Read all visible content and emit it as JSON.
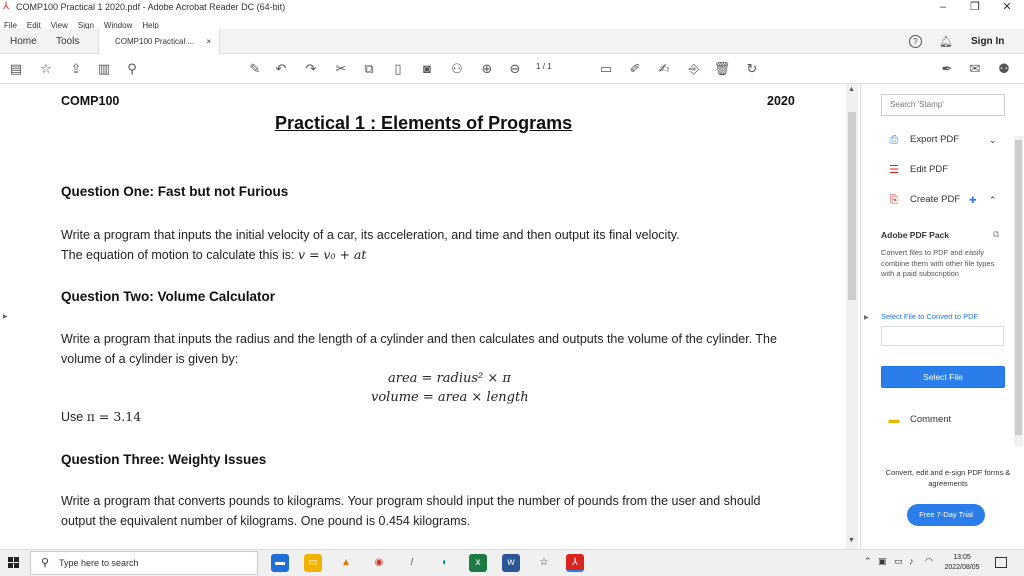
{
  "window": {
    "title": "COMP100 Practical 1 2020.pdf - Adobe Acrobat Reader DC (64-bit)",
    "minimize": "–",
    "maximize": "❐",
    "close": "✕"
  },
  "menu": [
    "File",
    "Edit",
    "View",
    "Sign",
    "Window",
    "Help"
  ],
  "tabs": {
    "home": "Home",
    "tools": "Tools",
    "document": "COMP100 Practical ...",
    "document_close": "×",
    "help": "?",
    "sign_in": "Sign In"
  },
  "toolbar": {
    "page_current": "1",
    "page_total": "/ 1"
  },
  "document": {
    "header_left": "COMP100",
    "header_right": "2020",
    "title": "Practical 1 : Elements of Programs",
    "q1_heading": "Question One: Fast but not Furious",
    "q1_text": "Write a program that inputs the initial velocity of a car, its acceleration, and time and then output its final velocity.",
    "q1_text2": "The equation of motion to calculate this is: ",
    "q1_formula": "v = v₀ + at",
    "q2_heading": "Question Two: Volume Calculator",
    "q2_text": "Write a program that inputs the radius and the length of a cylinder and then calculates and outputs the volume of the cylinder. The volume of a cylinder is given by:",
    "q2_eq1": "area = radius² × π",
    "q2_eq2": "volume = area  × length",
    "q2_use_prefix": "Use ",
    "q2_use_value": "π = 3.14",
    "q3_heading": "Question Three: Weighty Issues",
    "q3_text": "Write a program that converts pounds to kilograms. Your program should input the number of pounds from the user and should output the equivalent number of kilograms. One pound is 0.454 kilograms."
  },
  "right_panel": {
    "search_placeholder": "Search 'Stamp'",
    "export_pdf": "Export PDF",
    "edit_pdf": "Edit PDF",
    "create_pdf": "Create PDF",
    "pack_title": "Adobe PDF Pack",
    "pack_desc": "Convert files to PDF and easily combine them with other file types with a paid subscription",
    "select_link": "Select File to Convert to PDF",
    "select_button": "Select File",
    "comment": "Comment",
    "footer": "Convert, edit and e-sign PDF forms & agreements",
    "trial_button": "Free 7-Day Trial"
  },
  "taskbar": {
    "search_placeholder": "Type here to search",
    "time": "13:05",
    "date": "2022/08/05"
  },
  "colors": {
    "accent": "#2b7de9",
    "acrobat_red": "#d9231d"
  }
}
